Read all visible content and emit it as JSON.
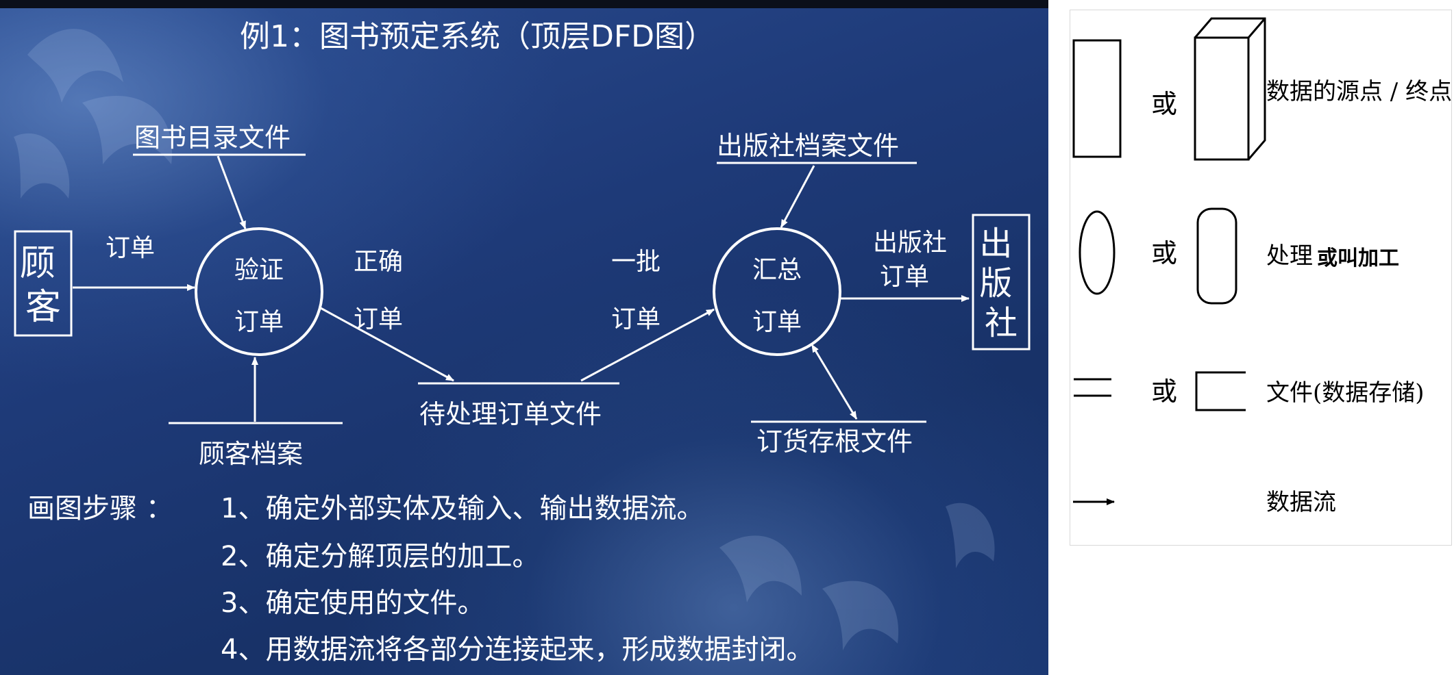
{
  "slide": {
    "title": "例1：图书预定系统（顶层DFD图）",
    "entities": {
      "customer": "顾客",
      "publisher": "出版社"
    },
    "processes": {
      "verify": [
        "验证",
        "订单"
      ],
      "summarize": [
        "汇总",
        "订单"
      ]
    },
    "stores": {
      "book_catalog": "图书目录文件",
      "customer_records": "顾客档案",
      "pending_orders": "待处理订单文件",
      "publisher_archive": "出版社档案文件",
      "order_stub": "订货存根文件"
    },
    "flows": {
      "order": "订单",
      "correct_order": [
        "正确",
        "订单"
      ],
      "batch_order": [
        "一批",
        "订单"
      ],
      "publisher_order": [
        "出版社",
        "订单"
      ]
    },
    "steps": {
      "label": "画图步骤 ：",
      "items": [
        "1、确定外部实体及输入、输出数据流。",
        "2、确定分解顶层的加工。",
        "3、确定使用的文件。",
        "4、用数据流将各部分连接起来，形成数据封闭。"
      ]
    },
    "colors": {
      "text": "#ffffff",
      "background": "#1e3a78"
    }
  },
  "legend": {
    "or": "或",
    "rows": [
      {
        "label": "数据的源点 / 终点"
      },
      {
        "label": "处理",
        "extra": "或叫加工"
      },
      {
        "label": "文件(数据存储)"
      },
      {
        "label": "数据流"
      }
    ]
  }
}
